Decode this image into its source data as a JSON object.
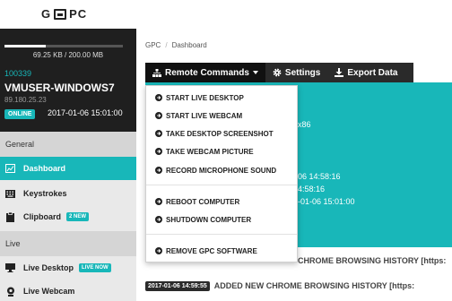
{
  "brand": {
    "logo_text_left": "G",
    "logo_text_right": "PC"
  },
  "account": {
    "usage_fraction": 0.345,
    "usage_text": "69.25 KB / 200.00 MB",
    "id": "100339",
    "hostname": "VMUSER-WINDOWS7",
    "ip": "89.180.25.23",
    "status_badge": "ONLINE",
    "last_seen": "2017-01-06 15:01:00"
  },
  "sidebar": {
    "section_general": "General",
    "section_live": "Live",
    "items": [
      {
        "label": "Dashboard",
        "icon": "dashboard-icon",
        "active": true
      },
      {
        "label": "Keystrokes",
        "icon": "keyboard-icon",
        "active": false
      },
      {
        "label": "Clipboard",
        "icon": "clipboard-icon",
        "badge": "2 NEW",
        "active": false
      },
      {
        "label": "Live Desktop",
        "icon": "monitor-icon",
        "badge": "LIVE NOW",
        "active": false
      },
      {
        "label": "Live Webcam",
        "icon": "webcam-icon",
        "active": false
      }
    ]
  },
  "breadcrumb": {
    "root": "GPC",
    "separator": "/",
    "current": "Dashboard"
  },
  "toolbar": {
    "remote_commands": "Remote Commands",
    "settings": "Settings",
    "export_data": "Export Data"
  },
  "panel": {
    "lines": [
      "x86",
      "06 14:58:16",
      "4:58:16",
      "-01-06 15:01:00"
    ]
  },
  "history": [
    {
      "text": "CHROME BROWSING HISTORY [https:"
    },
    {
      "time": "2017-01-06 14:59:55",
      "text": "ADDED NEW CHROME BROWSING HISTORY [https:"
    }
  ],
  "dropdown": {
    "items": [
      "START LIVE DESKTOP",
      "START LIVE WEBCAM",
      "TAKE DESKTOP SCREENSHOT",
      "TAKE WEBCAM PICTURE",
      "RECORD MICROPHONE SOUND",
      "REBOOT COMPUTER",
      "SHUTDOWN COMPUTER",
      "REMOVE GPC SOFTWARE"
    ]
  },
  "colors": {
    "accent": "#18b7b9",
    "dark": "#1f1f1f",
    "toolbar": "#2a2a2a"
  }
}
